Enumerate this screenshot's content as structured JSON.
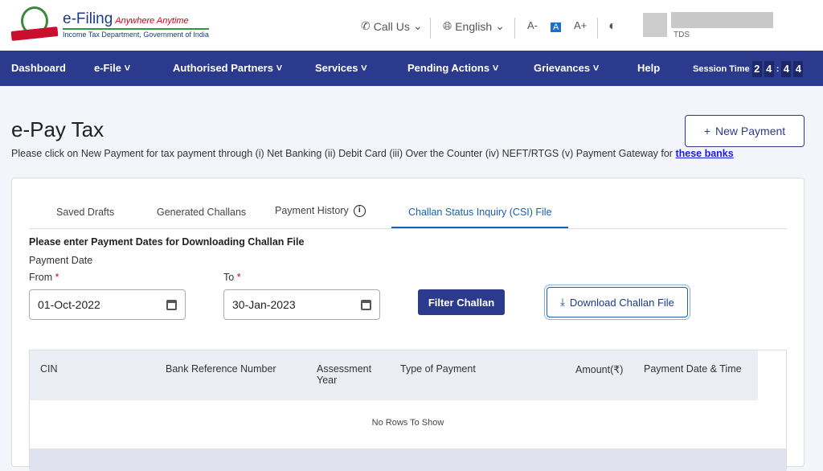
{
  "header": {
    "brand": "e-Filing",
    "tagline": "Anywhere Anytime",
    "dept": "Income Tax Department, Government of India",
    "call_us": "Call Us",
    "language": "English",
    "font_decrease": "A-",
    "font_default": "A",
    "font_increase": "A+",
    "user_role": "TDS"
  },
  "nav": {
    "items": [
      "Dashboard",
      "e-File",
      "Authorised Partners",
      "Services",
      "Pending Actions",
      "Grievances",
      "Help"
    ],
    "session_label": "Session Time",
    "session_digits": [
      "2",
      "4",
      "4",
      "4"
    ]
  },
  "page": {
    "title": "e-Pay Tax",
    "subtitle": "Please click on New Payment for tax payment through (i) Net Banking (ii) Debit Card (iii) Over the Counter (iv) NEFT/RTGS (v) Payment Gateway for ",
    "link": "these banks",
    "new_payment": "New Payment"
  },
  "tabs": [
    "Saved Drafts",
    "Generated Challans",
    "Payment History",
    "Challan Status Inquiry (CSI) File"
  ],
  "form": {
    "heading": "Please enter Payment Dates for Downloading Challan File",
    "payment_date": "Payment Date",
    "from_label": "From",
    "to_label": "To",
    "from_value": "01-Oct-2022",
    "to_value": "30-Jan-2023",
    "filter": "Filter Challan",
    "download": "Download Challan File"
  },
  "table": {
    "columns": [
      "CIN",
      "Bank Reference Number",
      "Assessment Year",
      "Type of Payment",
      "Amount(₹)",
      "Payment Date & Time"
    ],
    "empty": "No Rows To Show"
  }
}
